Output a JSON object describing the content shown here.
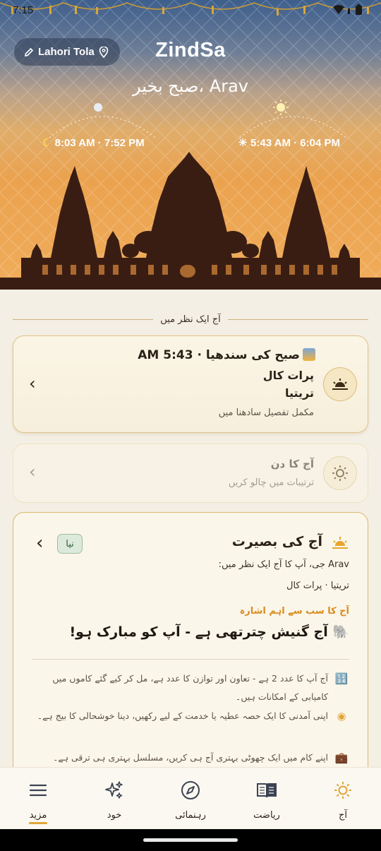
{
  "status_bar": {
    "time": "7:15"
  },
  "hero": {
    "location": "Lahori Tola",
    "brand": "ZindSa",
    "greeting": "صبح بخیر، Arav",
    "moon_times": "8:03 AM · 7:52 PM",
    "sun_times": "5:43 AM · 6:04 PM"
  },
  "glance_header": "آج ایک نظر میں",
  "sunrise_card": {
    "title": "صبح کی سندھیا · 5:43 AM",
    "line2": "پرات کال",
    "line3": "تریتیا",
    "line4": "مکمل تفصیل سادھنا میں"
  },
  "day_card": {
    "title": "آج کا دن",
    "subtitle": "ترتیبات میں چالو کریں"
  },
  "insight_card": {
    "title": "آج کی بصیرت",
    "badge": "نیا",
    "line1": "Arav جی، آپ کا آج ایک نظر میں:",
    "line2": "تریتیا · پرات کال",
    "highlight_label": "آج کا سب سے اہم اشارہ",
    "highlight": "آج گنیش چترتھی ہے - آپ کو مبارک ہو!",
    "points": [
      {
        "icon": "numbers-icon",
        "text": "آج آپ کا عدد 2 ہے - تعاون اور توازن کا عدد ہے، مل کر کیے گئے کاموں میں کامیابی کے امکانات ہیں۔"
      },
      {
        "icon": "coin-icon",
        "text": "اپنی آمدنی کا ایک حصہ عطیہ یا خدمت کے لیے رکھیں، دینا خوشحالی کا بیج ہے۔"
      },
      {
        "icon": "briefcase-icon",
        "text": "اپنے کام میں ایک چھوٹی بہتری آج ہی کریں، مسلسل بہتری ہی ترقی ہے۔"
      }
    ]
  },
  "bottom_nav": {
    "items": [
      {
        "label": "آج",
        "icon": "sun-icon"
      },
      {
        "label": "ریاضت",
        "icon": "book-icon"
      },
      {
        "label": "رہنمائی",
        "icon": "compass-icon"
      },
      {
        "label": "خود",
        "icon": "sparkles-icon"
      },
      {
        "label": "مزید",
        "icon": "menu-icon"
      }
    ]
  },
  "colors": {
    "accent": "#e0a53a",
    "card_border": "#d9b870",
    "text_primary": "#2b2118"
  }
}
